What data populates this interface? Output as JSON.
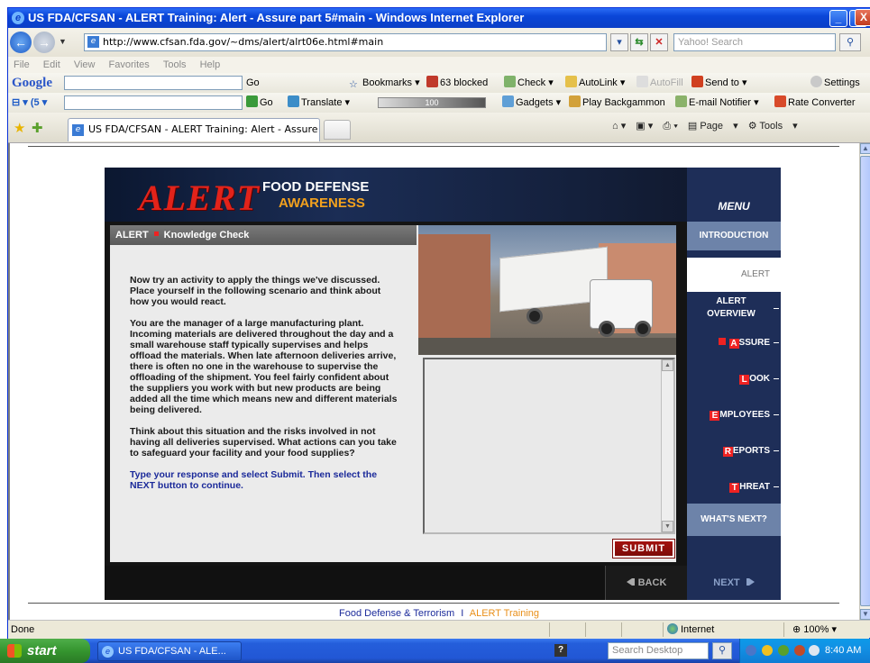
{
  "window": {
    "title": "US FDA/CFSAN - ALERT Training: Alert - Assure part 5#main - Windows Internet Explorer",
    "min_label": "_",
    "max_label": "□",
    "close_label": "X"
  },
  "address": {
    "url": "http://www.cfsan.fda.gov/~dms/alert/alrt06e.html#main",
    "search_placeholder": "Yahoo! Search"
  },
  "menubar": [
    "File",
    "Edit",
    "View",
    "Favorites",
    "Tools",
    "Help"
  ],
  "google_toolbar": {
    "brand": "Google",
    "go": "Go",
    "bookmarks": "Bookmarks",
    "blocked": "63 blocked",
    "check": "Check",
    "autolink": "AutoLink",
    "autofill": "AutoFill",
    "send_to": "Send to",
    "settings": "Settings"
  },
  "second_toolbar": {
    "go": "Go",
    "translate": "Translate",
    "volume": "100",
    "gadgets": "Gadgets",
    "backgammon": "Play Backgammon",
    "email_notifier": "E-mail Notifier",
    "rate_converter": "Rate Converter"
  },
  "tabs": {
    "active_label": "US FDA/CFSAN - ALERT Training: Alert - Assure part ...",
    "page": "Page",
    "tools": "Tools"
  },
  "alert": {
    "logo": "ALERT",
    "food_defense": "FOOD DEFENSE",
    "awareness": "AWARENESS",
    "section": "ALERT",
    "section_sub": "Knowledge Check",
    "paragraphs": [
      "Now try an activity to apply the things we've discussed. Place yourself in the following scenario and think about how you would react.",
      "You are the manager of a large manufacturing plant. Incoming materials are delivered throughout the day and a small warehouse staff typically supervises and helps offload the materials. When late afternoon deliveries arrive, there is often no one in the warehouse to supervise the offloading of the shipment. You feel fairly confident about the suppliers you work with but new products are being added all the time which means new and different materials being delivered.",
      "Think about this situation and the risks involved in not having all deliveries supervised. What actions can you take to safeguard your facility and your food supplies?"
    ],
    "instruction": "Type your response and select Submit. Then select the NEXT button to continue.",
    "submit": "SUBMIT",
    "back": "BACK",
    "next": "NEXT"
  },
  "menu": {
    "title": "MENU",
    "introduction": "INTRODUCTION",
    "alert": "ALERT",
    "alert_overview": "ALERT OVERVIEW",
    "assure_cap": "A",
    "assure_rest": "SSURE",
    "look_cap": "L",
    "look_rest": "OOK",
    "employees_cap": "E",
    "employees_rest": "MPLOYEES",
    "reports_cap": "R",
    "reports_rest": "EPORTS",
    "threat_cap": "T",
    "threat_rest": "HREAT",
    "whats_next": "WHAT'S NEXT?"
  },
  "footer": {
    "link1": "Food Defense & Terrorism",
    "sep": "I",
    "link2": "ALERT Training"
  },
  "status": {
    "text": "Done",
    "zone": "Internet",
    "zoom": "100%"
  },
  "taskbar": {
    "start": "start",
    "ie_task": "US FDA/CFSAN - ALE...",
    "search_placeholder": "Search Desktop",
    "time": "8:40 AM"
  }
}
